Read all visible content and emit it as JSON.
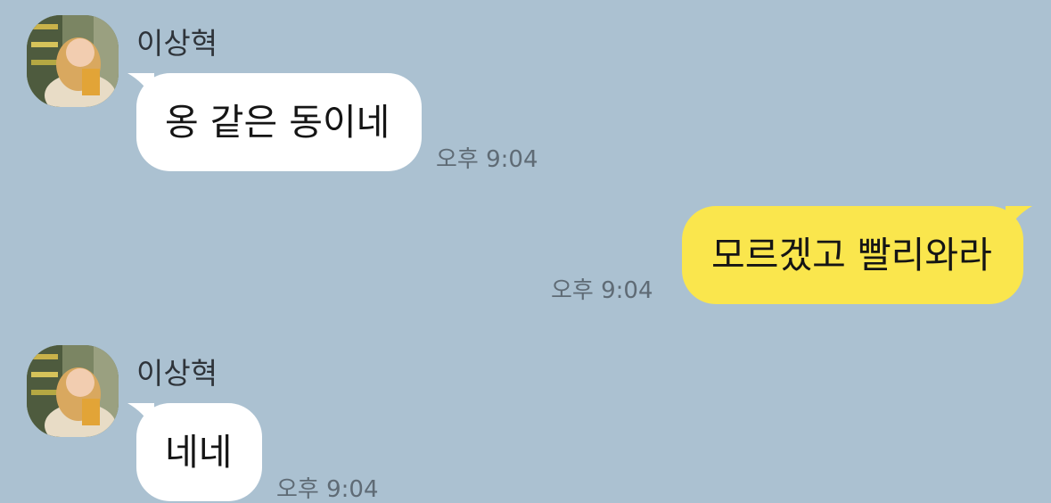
{
  "colors": {
    "background": "#abc1d1",
    "incoming_bubble": "#ffffff",
    "outgoing_bubble": "#fae64d"
  },
  "messages": [
    {
      "direction": "incoming",
      "sender": "이상혁",
      "text": "옹 같은 동이네",
      "time": "오후 9:04",
      "avatar_icon": "profile-photo"
    },
    {
      "direction": "outgoing",
      "text": "모르겠고 빨리와라",
      "time": "오후 9:04"
    },
    {
      "direction": "incoming",
      "sender": "이상혁",
      "text": "네네",
      "time": "오후 9:04",
      "avatar_icon": "profile-photo"
    }
  ]
}
